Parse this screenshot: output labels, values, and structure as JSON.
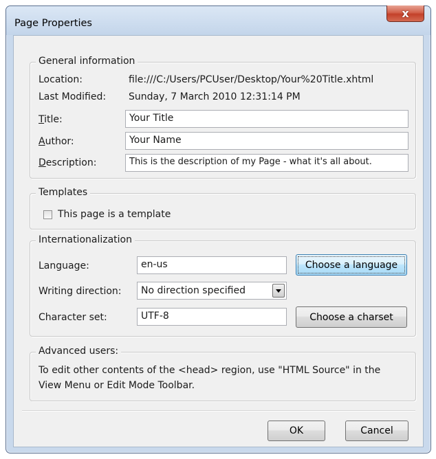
{
  "window": {
    "title": "Page Properties",
    "close_glyph": "x"
  },
  "general": {
    "legend": "General information",
    "location_label": "Location:",
    "location_value": "file:///C:/Users/PCUser/Desktop/Your%20Title.xhtml",
    "modified_label": "Last Modified:",
    "modified_value": "Sunday, 7 March 2010 12:31:14 PM",
    "title_label_key": "T",
    "title_label_rest": "itle:",
    "title_value": "Your Title",
    "author_label_key": "A",
    "author_label_rest": "uthor:",
    "author_value": "Your Name",
    "description_label_key": "D",
    "description_label_rest": "escription:",
    "description_value": "This is the description of my Page - what it's all about."
  },
  "templates": {
    "legend": "Templates",
    "checkbox_label": "This page is a template",
    "checked": false
  },
  "i18n": {
    "legend": "Internationalization",
    "language_label": "Language:",
    "language_value": "en-us",
    "choose_language_button": "Choose a language",
    "direction_label": "Writing direction:",
    "direction_value": "No direction specified",
    "charset_label": "Character set:",
    "charset_value": "UTF-8",
    "choose_charset_button": "Choose a charset"
  },
  "advanced": {
    "legend": "Advanced users:",
    "line1": "To edit other contents of the <head> region, use \"HTML Source\" in the",
    "line2": "View Menu or Edit Mode Toolbar."
  },
  "footer": {
    "ok_button": "OK",
    "cancel_button": "Cancel"
  }
}
